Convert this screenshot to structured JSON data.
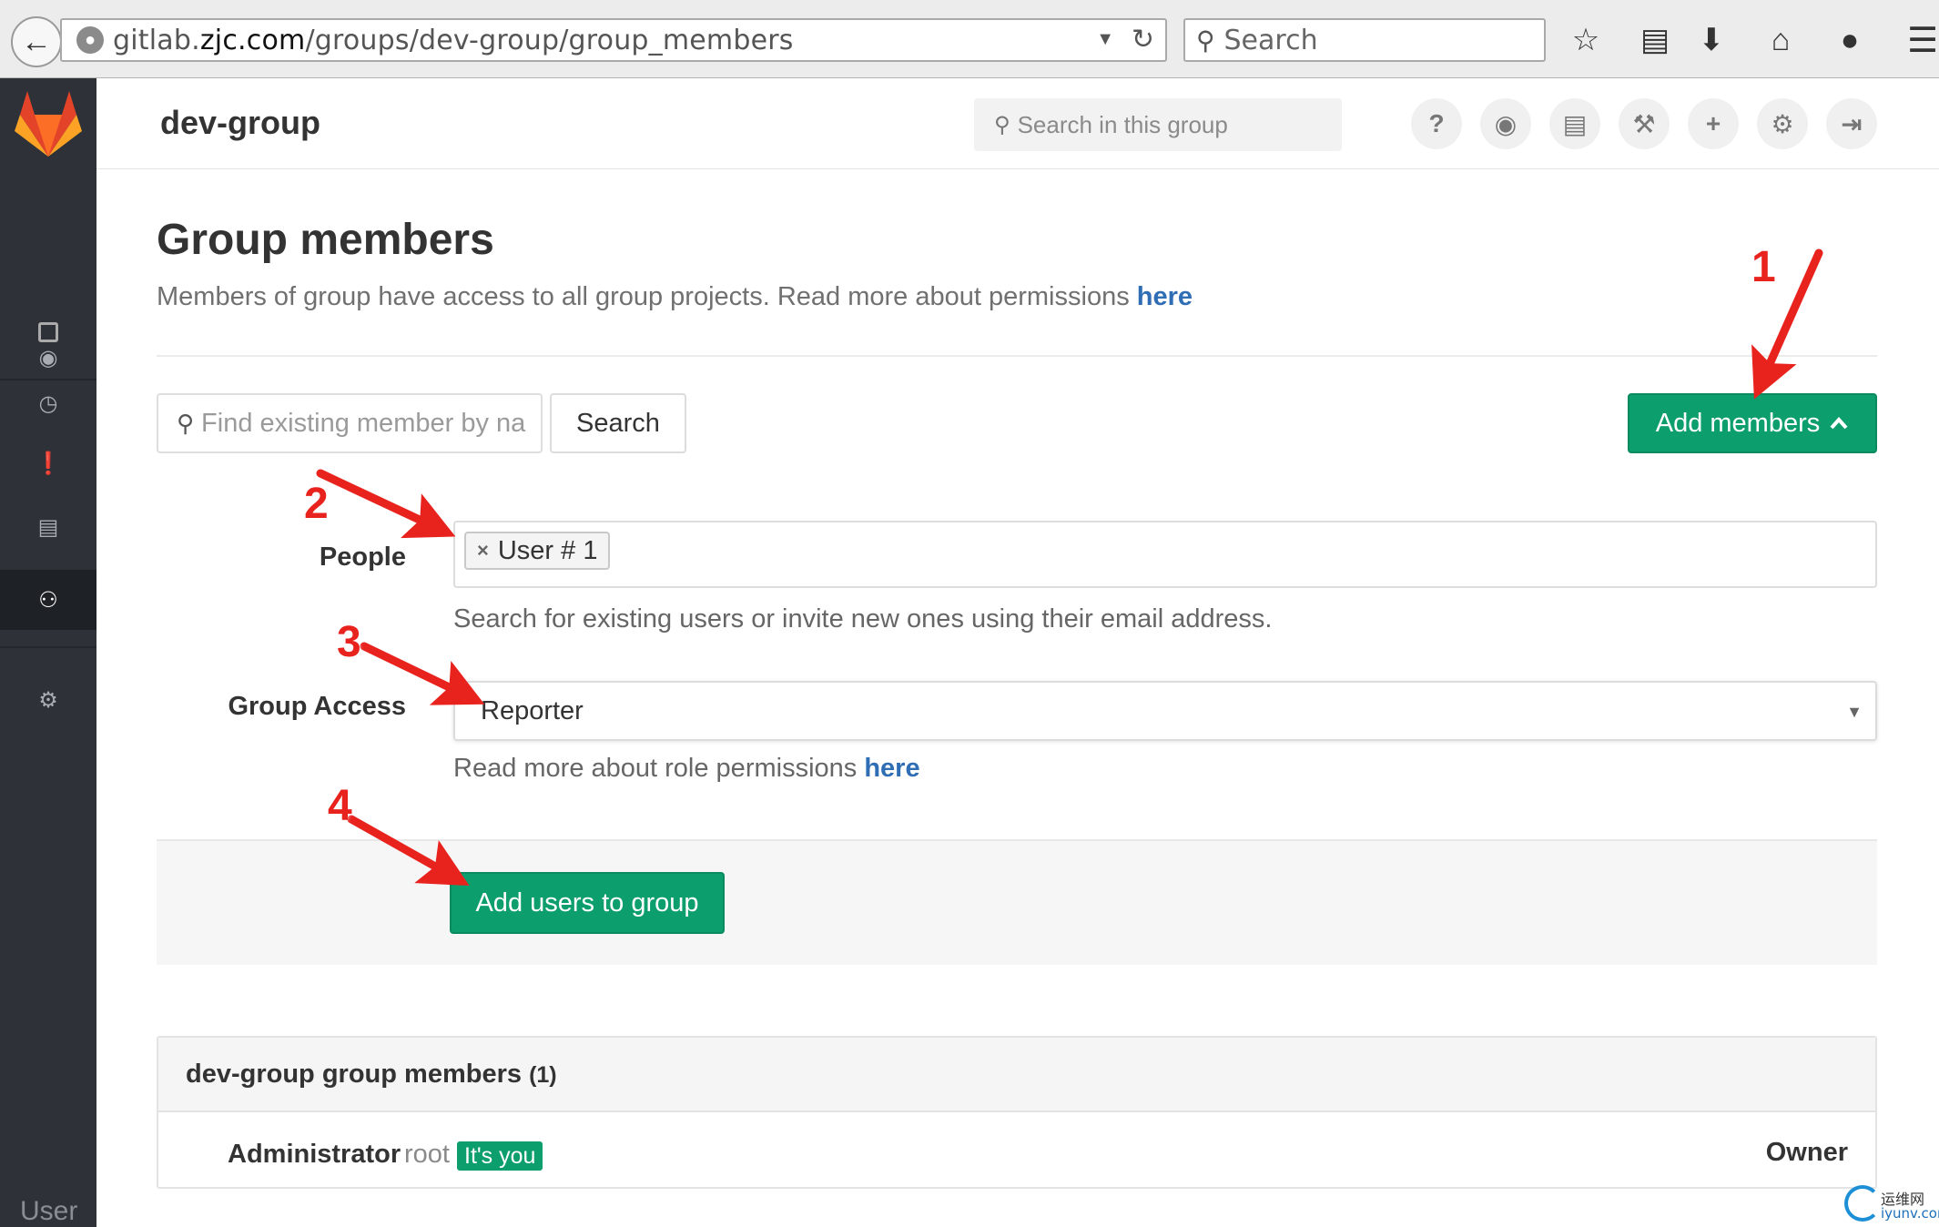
{
  "browser": {
    "url_prefix": "gitlab.",
    "url_host": "zjc.com",
    "url_path": "/groups/dev-group/group_members",
    "search_placeholder": "Search",
    "icons": [
      "back-icon",
      "globe-icon",
      "reload-icon",
      "search-icon",
      "star-icon",
      "reading-list-icon",
      "download-icon",
      "home-icon",
      "chat-icon",
      "menu-icon"
    ]
  },
  "header": {
    "group_name": "dev-group",
    "search_placeholder": "Search in this group",
    "buttons": [
      "help-icon",
      "explore-icon",
      "snippets-icon",
      "admin-icon",
      "new-project-icon",
      "settings-icon",
      "sign-out-icon"
    ]
  },
  "sidebar": {
    "items": [
      "toggle-sidebar-icon",
      "activity-icon",
      "milestones-icon",
      "issues-icon",
      "merge-requests-icon",
      "members-icon",
      "settings-icon"
    ],
    "footer_label": "User"
  },
  "page": {
    "title": "Group members",
    "description": "Members of group have access to all group projects. Read more about permissions ",
    "description_link": "here"
  },
  "filter": {
    "placeholder": "Find existing member by na",
    "search_label": "Search"
  },
  "add_members_label": "Add members",
  "form": {
    "people_label": "People",
    "people_token": "User # 1",
    "people_help": "Search for existing users or invite new ones using their email address.",
    "access_label": "Group Access",
    "access_value": "Reporter",
    "access_help": "Read more about role permissions ",
    "access_help_link": "here",
    "submit_label": "Add users to group"
  },
  "members": {
    "heading": "dev-group group members",
    "count": "(1)",
    "rows": [
      {
        "name": "Administrator",
        "username": "root",
        "badge": "It's you",
        "role": "Owner"
      }
    ]
  },
  "annotations": [
    "1",
    "2",
    "3",
    "4"
  ],
  "annotation_color": "#e8231e",
  "accent_color": "#0d9e6e",
  "watermark": {
    "line1": "运维网",
    "line2": "iyunv.com"
  }
}
